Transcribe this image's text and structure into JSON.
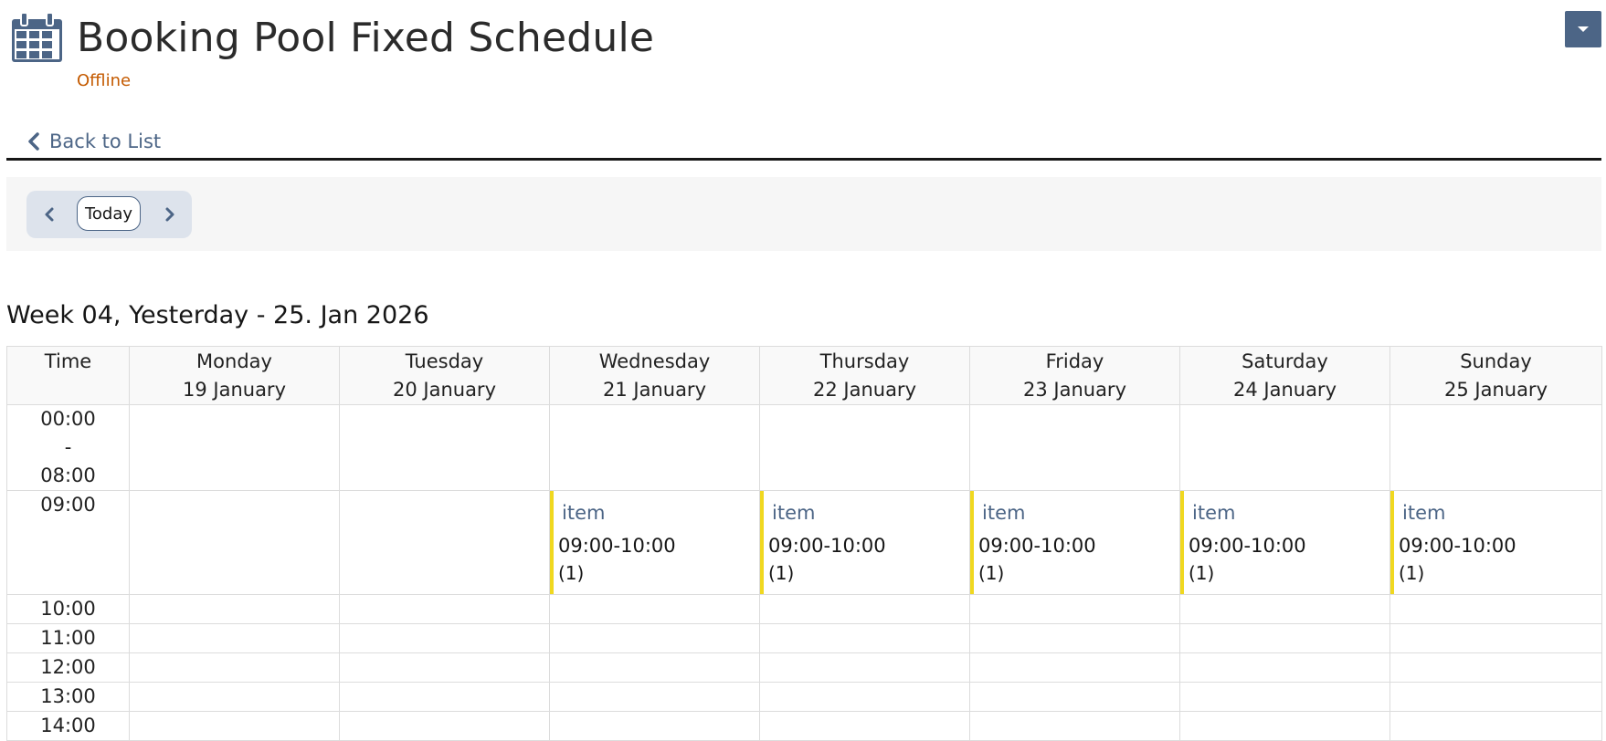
{
  "header": {
    "title": "Booking Pool Fixed Schedule",
    "status": "Offline"
  },
  "nav": {
    "back_label": "Back to List",
    "today_label": "Today"
  },
  "week_title": "Week 04, Yesterday - 25. Jan 2026",
  "columns": {
    "time": "Time",
    "days": [
      {
        "day": "Monday",
        "date": "19 January"
      },
      {
        "day": "Tuesday",
        "date": "20 January"
      },
      {
        "day": "Wednesday",
        "date": "21 January"
      },
      {
        "day": "Thursday",
        "date": "22 January"
      },
      {
        "day": "Friday",
        "date": "23 January"
      },
      {
        "day": "Saturday",
        "date": "24 January"
      },
      {
        "day": "Sunday",
        "date": "25 January"
      }
    ]
  },
  "slots": {
    "night": {
      "start": "00:00",
      "sep": "-",
      "end": "08:00"
    },
    "nine": "09:00",
    "hours": [
      "10:00",
      "11:00",
      "12:00",
      "13:00",
      "14:00"
    ]
  },
  "events": {
    "wed": {
      "name": "item",
      "range": "09:00-10:00",
      "count": "(1)"
    },
    "thu": {
      "name": "item",
      "range": "09:00-10:00",
      "count": "(1)"
    },
    "fri": {
      "name": "item",
      "range": "09:00-10:00",
      "count": "(1)"
    },
    "sat": {
      "name": "item",
      "range": "09:00-10:00",
      "count": "(1)"
    },
    "sun": {
      "name": "item",
      "range": "09:00-10:00",
      "count": "(1)"
    }
  },
  "icons": {
    "calendar": "calendar-icon",
    "menu": "caret-down-icon",
    "back": "chevron-left-icon",
    "prev": "chevron-left-icon",
    "next": "chevron-right-icon"
  },
  "colors": {
    "accent": "#4c6586",
    "status": "#c45a00",
    "event_bar": "#f0d820",
    "nav_group_bg": "#dde3ec",
    "toolbar_bg": "#f6f6f6"
  }
}
